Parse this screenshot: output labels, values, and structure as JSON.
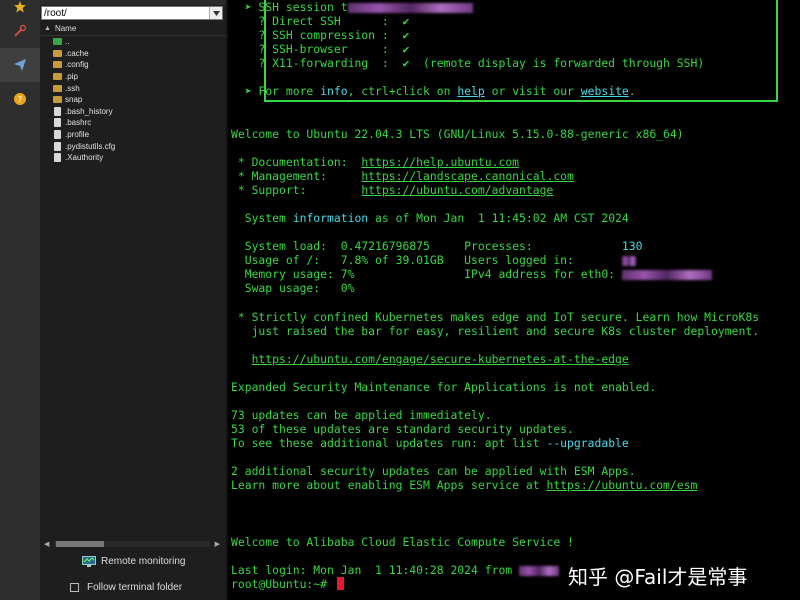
{
  "browser": {
    "path": "/root/",
    "column_name": "Name",
    "files": [
      {
        "name": "..",
        "kind": "parent"
      },
      {
        "name": ".cache",
        "kind": "folder"
      },
      {
        "name": ".config",
        "kind": "folder"
      },
      {
        "name": ".pip",
        "kind": "folder"
      },
      {
        "name": ".ssh",
        "kind": "folder"
      },
      {
        "name": "snap",
        "kind": "folder"
      },
      {
        "name": ".bash_history",
        "kind": "file"
      },
      {
        "name": ".bashrc",
        "kind": "file"
      },
      {
        "name": ".profile",
        "kind": "file"
      },
      {
        "name": ".pydistutils.cfg",
        "kind": "file"
      },
      {
        "name": ".Xauthority",
        "kind": "file"
      }
    ],
    "remote_monitoring": "Remote monitoring",
    "follow_folder": "Follow terminal folder"
  },
  "terminal": {
    "box": {
      "ssh_session": "  ➤ SSH session t",
      "direct_ssh": "    ? Direct SSH      :  ✔",
      "compression": "    ? SSH compression :  ✔",
      "browser": "    ? SSH-browser     :  ✔",
      "x11_a": "    ? X11-forwarding  :  ✔  (remote display is forwarded through SSH)",
      "more_a": "  ➤ For more ",
      "more_info": "info",
      "more_b": ", ctrl+click on ",
      "more_help": "help",
      "more_c": " or visit our ",
      "more_website": "website",
      "more_d": "."
    },
    "welcome": "Welcome to Ubuntu 22.04.3 LTS (GNU/Linux 5.15.0-88-generic x86_64)",
    "doc_label": " * Documentation:  ",
    "doc_url": "https://help.ubuntu.com",
    "mgmt_label": " * Management:     ",
    "mgmt_url": "https://landscape.canonical.com",
    "support_label": " * Support:        ",
    "support_url": "https://ubuntu.com/advantage",
    "sysinfo_a": "  System ",
    "sysinfo_b": "information",
    "sysinfo_c": " as of Mon Jan  1 11:45:02 AM CST 2024",
    "load_a": "  System load:  0.47216796875     Processes:             ",
    "load_b": "130",
    "usage": "  Usage of /:   7.8% of 39.01GB   Users logged in:       ",
    "memory": "  Memory usage: 7%                IPv4 address for eth0: ",
    "swap": "  Swap usage:   0%",
    "k8s_1": " * Strictly confined Kubernetes makes edge and IoT secure. Learn how MicroK8s",
    "k8s_2": "   just raised the bar for easy, resilient and secure K8s cluster deployment.",
    "k8s_url": "https://ubuntu.com/engage/secure-kubernetes-at-the-edge",
    "esm": "Expanded Security Maintenance for Applications is not enabled.",
    "upd_1": "73 updates can be applied immediately.",
    "upd_2": "53 of these updates are standard security updates.",
    "upd_3a": "To see these additional updates run: apt list ",
    "upd_3b": "--upgradable",
    "esm_1": "2 additional security updates can be applied with ESM Apps.",
    "esm_2a": "Learn more about enabling ESM Apps service at ",
    "esm_2b": "https://ubuntu.com/esm",
    "alibaba": "Welcome to Alibaba Cloud Elastic Compute Service !",
    "last_login": "Last login: Mon Jan  1 11:40:28 2024 from ",
    "prompt": "root@Ubuntu:~# "
  },
  "watermark": "知乎 @Fail才是常事"
}
